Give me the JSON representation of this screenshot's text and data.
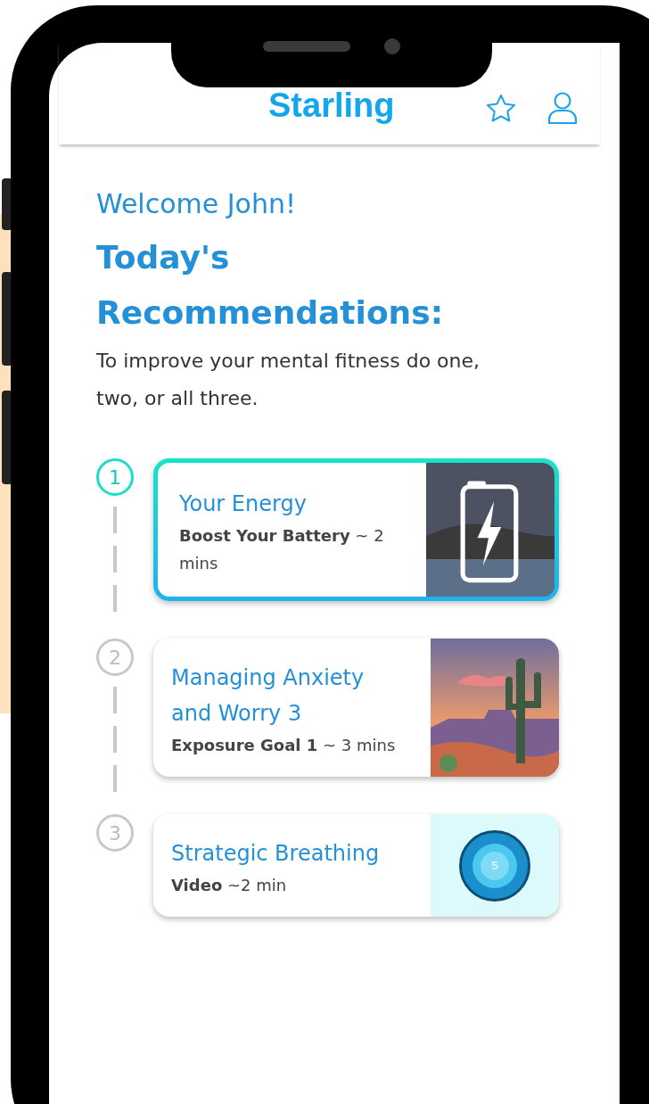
{
  "header": {
    "logo": "Starling"
  },
  "greeting": "Welcome John!",
  "heading": "Today's Recommendations:",
  "intro": "To improve your mental fitness do one, two, or all three.",
  "recommendations": [
    {
      "step": "1",
      "selected": true,
      "title": "Your Energy",
      "activity": "Boost Your Battery",
      "duration": "~ 2 mins",
      "kind": "battery"
    },
    {
      "step": "2",
      "selected": false,
      "title": "Managing Anxiety and Worry 3",
      "activity": "Exposure Goal 1",
      "duration": "~ 3 mins",
      "kind": "desert"
    },
    {
      "step": "3",
      "selected": false,
      "title": "Strategic Breathing",
      "activity": "Video",
      "duration": "~2 min",
      "kind": "breathing",
      "image_label": "5"
    }
  ]
}
